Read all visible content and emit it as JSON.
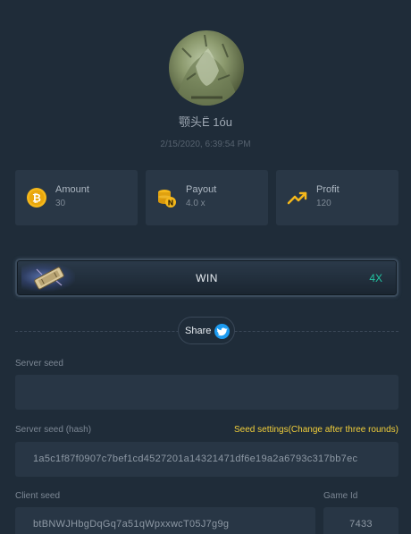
{
  "profile": {
    "username": "颚头Ё 1óu",
    "datetime": "2/15/2020, 6:39:54 PM"
  },
  "stats": [
    {
      "label": "Amount",
      "value": "30",
      "icon": "bitcoin-icon"
    },
    {
      "label": "Payout",
      "value": "4.0 x",
      "icon": "coin-stack-icon"
    },
    {
      "label": "Profit",
      "value": "120",
      "icon": "trending-up-icon"
    }
  ],
  "result": {
    "label": "WIN",
    "multiplier": "4X",
    "icon": "ticket-icon"
  },
  "share": {
    "label": "Share",
    "icon": "twitter-icon"
  },
  "server_seed": {
    "label": "Server seed",
    "value": ""
  },
  "server_seed_hash": {
    "label": "Server seed (hash)",
    "settings_link": "Seed settings(Change after three rounds)",
    "value": "1a5c1f87f0907c7bef1cd4527201a14321471df6e19a2a6793c317bb7ec"
  },
  "client_seed": {
    "label": "Client seed",
    "value": "btBNWJHbgDqGq7a51qWpxxwcT05J7g9g"
  },
  "game_id": {
    "label": "Game Id",
    "value": "7433"
  },
  "colors": {
    "background": "#1f2c39",
    "card": "#293746",
    "accent_green": "#22c3a1",
    "accent_yellow": "#f2cf3a",
    "twitter_blue": "#1d9bf0"
  }
}
